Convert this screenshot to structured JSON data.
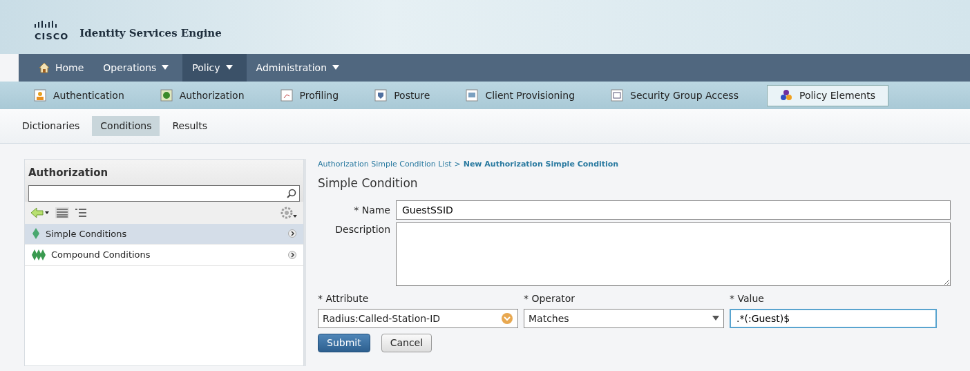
{
  "header": {
    "logo": "CISCO",
    "title": "Identity Services Engine"
  },
  "main_menu": [
    {
      "label": "Home",
      "selected": false,
      "dropdown": false
    },
    {
      "label": "Operations",
      "selected": false,
      "dropdown": true
    },
    {
      "label": "Policy",
      "selected": true,
      "dropdown": true
    },
    {
      "label": "Administration",
      "selected": false,
      "dropdown": true
    }
  ],
  "policy_tabs": [
    {
      "label": "Authentication",
      "selected": false
    },
    {
      "label": "Authorization",
      "selected": false
    },
    {
      "label": "Profiling",
      "selected": false
    },
    {
      "label": "Posture",
      "selected": false
    },
    {
      "label": "Client Provisioning",
      "selected": false
    },
    {
      "label": "Security Group Access",
      "selected": false
    },
    {
      "label": "Policy Elements",
      "selected": true
    }
  ],
  "sub_tabs": [
    {
      "label": "Dictionaries",
      "selected": false
    },
    {
      "label": "Conditions",
      "selected": true
    },
    {
      "label": "Results",
      "selected": false
    }
  ],
  "sidebar": {
    "title": "Authorization",
    "items": [
      {
        "label": "Simple Conditions",
        "kind": "simple",
        "selected": true
      },
      {
        "label": "Compound Conditions",
        "kind": "compound",
        "selected": false
      }
    ]
  },
  "breadcrumb": {
    "link": "Authorization Simple Condition List",
    "separator": ">",
    "current": "New Authorization Simple Condition"
  },
  "form": {
    "title": "Simple Condition",
    "name": {
      "label": "* Name",
      "value": "GuestSSID"
    },
    "description": {
      "label": "Description"
    },
    "attribute": {
      "label": "* Attribute",
      "value": "Radius:Called-Station-ID"
    },
    "operator": {
      "label": "* Operator",
      "value": "Matches"
    },
    "value": {
      "label": "* Value",
      "value": ".*(:Guest)$",
      "focused": true
    }
  },
  "buttons": [
    {
      "label": "Submit",
      "kind": "primary"
    },
    {
      "label": "Cancel",
      "kind": "secondary"
    }
  ]
}
